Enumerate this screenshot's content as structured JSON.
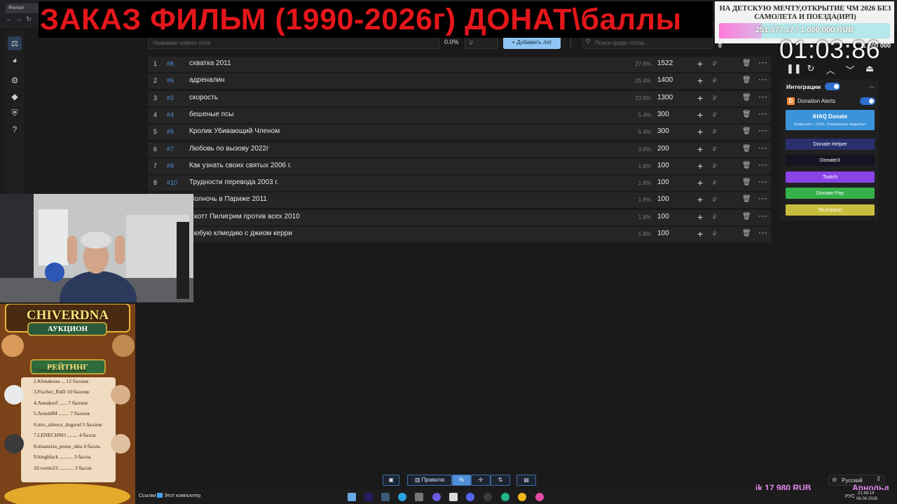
{
  "browser": {
    "tab_title": "Фильм",
    "address": ""
  },
  "banner": {
    "text": "ЗАКАЗ ФИЛЬМ (1990-2026г) ДОНАТ\\баллы"
  },
  "goal": {
    "title": "НА ДЕТСКУЮ МЕЧТУ,ОТКРЫТИЕ ЧМ 2026 БЕЗ САМОЛЕТА И ПОЕЗДА(ИРЛ)",
    "amount_text": "251 377.17 / 1 000 000 RUB",
    "progress": 0.2514,
    "min_label": "0",
    "max_label": "1 000 000",
    "colors": {
      "fill": "#ff7ad9",
      "track": "#b4e8ea"
    }
  },
  "toolbar": {
    "lot_name_placeholder": "Название нового лота",
    "percent_value": "0.0%",
    "currency_placeholder": "₽",
    "add_lot_label": "Добавить лот",
    "search_placeholder": "Поиск среди лотов..."
  },
  "lots": [
    {
      "num": "1",
      "id": "#8",
      "name": "схватка 2011",
      "pct": "27.6%",
      "amount": "1522"
    },
    {
      "num": "2",
      "id": "#6",
      "name": "адреналин",
      "pct": "25.4%",
      "amount": "1400"
    },
    {
      "num": "3",
      "id": "#3",
      "name": "скорость",
      "pct": "23.5%",
      "amount": "1300"
    },
    {
      "num": "4",
      "id": "#4",
      "name": "бешеные псы",
      "pct": "5.4%",
      "amount": "300"
    },
    {
      "num": "5",
      "id": "#5",
      "name": "Кролик Убивающий Членом",
      "pct": "5.4%",
      "amount": "300"
    },
    {
      "num": "6",
      "id": "#7",
      "name": "Любовь по вызову 2022г",
      "pct": "3.6%",
      "amount": "200"
    },
    {
      "num": "7",
      "id": "#9",
      "name": "Как узнать своих святых 2006 г.",
      "pct": "1.8%",
      "amount": "100"
    },
    {
      "num": "8",
      "id": "#10",
      "name": "Трудности перевода 2003 г.",
      "pct": "1.8%",
      "amount": "100"
    },
    {
      "num": "",
      "id": "",
      "name": "Полночь в Париже 2011",
      "pct": "1.8%",
      "amount": "100"
    },
    {
      "num": "",
      "id": "",
      "name": "Скотт Пилигрим против всех 2010",
      "pct": "1.8%",
      "amount": "100"
    },
    {
      "num": "",
      "id": "",
      "name": "Любую клмедию с джиом керри",
      "pct": "1.8%",
      "amount": "100"
    }
  ],
  "row_icons": {
    "plus": "+",
    "currency": "₽",
    "delete": "🗑",
    "more": "⋯"
  },
  "timer": {
    "value": "01:03:86"
  },
  "integrations": {
    "title": "Интеграции",
    "donation_alerts_label": "Donation Alerts",
    "ihaq_title": "IHAQ Donate",
    "ihaq_subtitle": "Комиссия – 3,5%. Уникальные виджеты!",
    "services": [
      {
        "label": "Donate Helper",
        "color": "#2b2f6e"
      },
      {
        "label": "DonateX",
        "color": "#151522"
      },
      {
        "label": "Twitch",
        "color": "#8a44e6"
      },
      {
        "label": "Donate Pay",
        "color": "#36b049"
      },
      {
        "label": "Tournique!",
        "color": "#c9be3c"
      }
    ]
  },
  "leaderboard": {
    "title": "CHIVERDNA",
    "subtitle": "АУКЦИОН",
    "heading": "РЕЙТИНГ",
    "entries": [
      "1.Lesnik_bs... 16 баллов",
      "2.Klotakouu ... 12 баллов",
      "3.Fischer_RnD 10 баллов",
      "4.Annakorf ...... 7 баллов",
      "5.ArnoldM ........ 7 баллов",
      "6.mrs_silence_dogood 5 баллов",
      "7.LENECHNO ........ 4 балла",
      "8.nisansiza_posse_skta 4 балла",
      "9.bingblack .......... 3 балла",
      "10.vortie23 ........... 3 балла"
    ]
  },
  "bottom_toolbar": {
    "rules_label": "Правила"
  },
  "language": {
    "selected": "Русский"
  },
  "ticker": {
    "text": "ik 17 980 RUB",
    "name": "Арнольд"
  },
  "taskbar": {
    "links_label": "Ссылки",
    "computer_label": "Этот компьютер",
    "lang": "РУС",
    "time": "21:48:14",
    "date": "06.04.2026"
  }
}
